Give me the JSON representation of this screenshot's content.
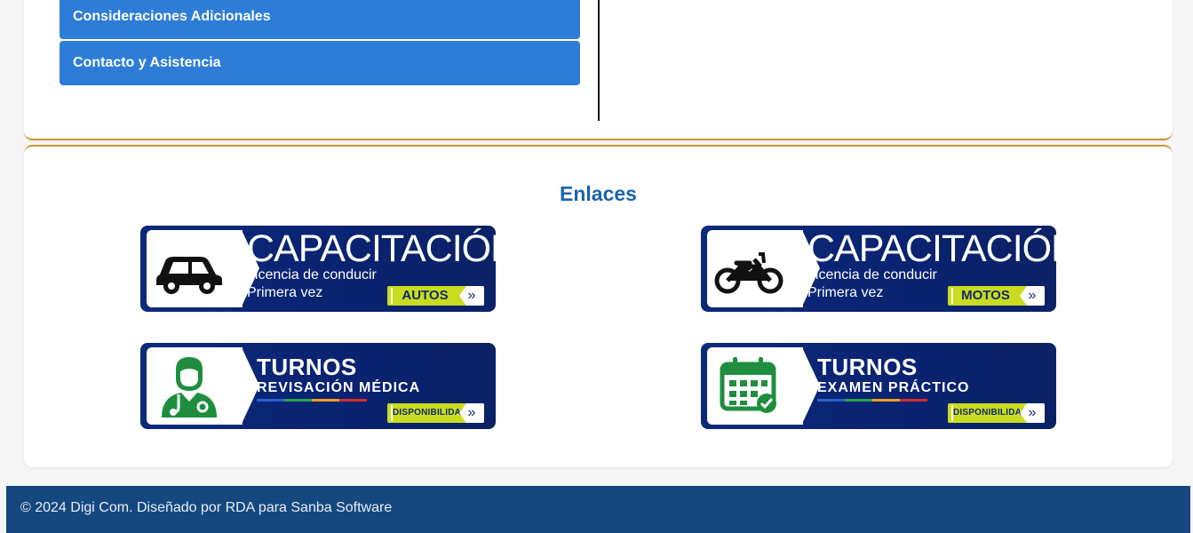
{
  "menu": {
    "items": [
      {
        "label": "Consideraciones Adicionales"
      },
      {
        "label": "Contacto y Asistencia"
      }
    ]
  },
  "links": {
    "title": "Enlaces",
    "banners": [
      {
        "heading": "CAPACITACIÓN",
        "line1": "Licencia de conducir",
        "line2": "Primera vez",
        "tag": "AUTOS",
        "icon": "car-icon"
      },
      {
        "heading": "CAPACITACIÓN",
        "line1": "Licencia de conducir",
        "line2": "Primera vez",
        "tag": "MOTOS",
        "icon": "motorcycle-icon"
      },
      {
        "heading": "TURNOS",
        "line1": "REVISACIÓN MÉDICA",
        "tag": "DISPONIBILIDAD",
        "icon": "doctor-icon"
      },
      {
        "heading": "TURNOS",
        "line1": "EXAMEN PRÁCTICO",
        "tag": "DISPONIBILIDAD",
        "icon": "calendar-check-icon"
      }
    ],
    "arrow": "»"
  },
  "footer": {
    "text": "© 2024 Digi Com. Diseñado por RDA para Sanba Software"
  },
  "colors": {
    "menu_button": "#2d7dd8",
    "title": "#1e63ab",
    "banner_bg": "#0d2a78",
    "tag_bg": "#c9dc1f",
    "footer_bg": "#15487f",
    "accent_border": "#c9962f"
  }
}
